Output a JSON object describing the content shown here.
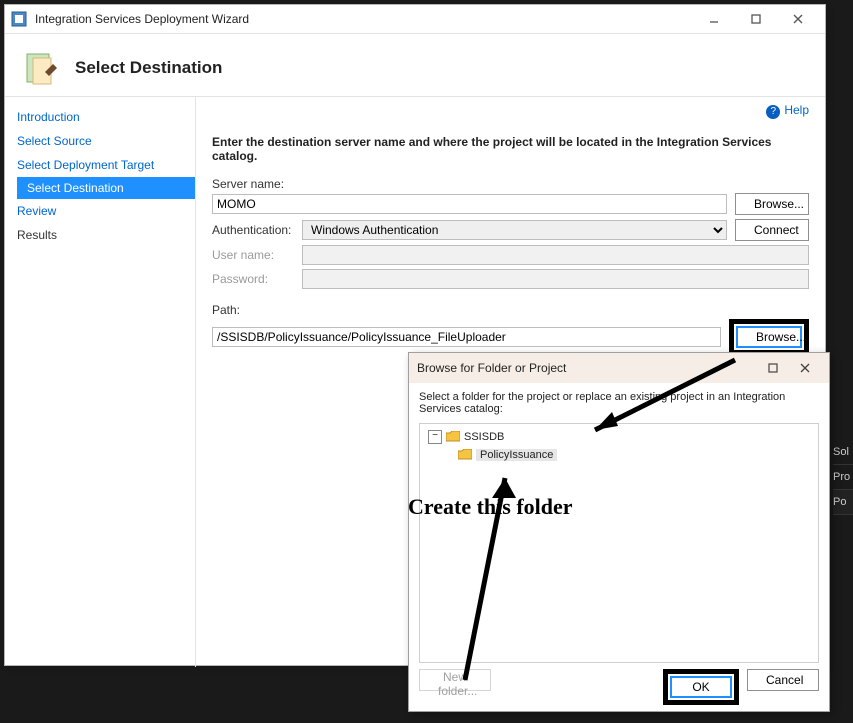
{
  "title": "Integration Services Deployment Wizard",
  "banner_title": "Select Destination",
  "help_label": "Help",
  "nav": {
    "introduction": "Introduction",
    "select_source": "Select Source",
    "select_target": "Select Deployment Target",
    "select_destination": "Select Destination",
    "review": "Review",
    "results": "Results"
  },
  "content": {
    "instruction": "Enter the destination server name and where the project will be located in the Integration Services catalog.",
    "server_label": "Server name:",
    "server_value": "MOMO",
    "browse_label": "Browse...",
    "auth_label": "Authentication:",
    "auth_value": "Windows Authentication",
    "connect_label": "Connect",
    "user_label": "User name:",
    "user_value": "",
    "pwd_label": "Password:",
    "pwd_value": "",
    "path_label": "Path:",
    "path_value": "/SSISDB/PolicyIssuance/PolicyIssuance_FileUploader"
  },
  "dialog": {
    "title": "Browse for Folder or Project",
    "instruction": "Select a folder for the project or replace an existing project in an Integration Services catalog:",
    "root": "SSISDB",
    "child": "PolicyIssuance",
    "new_folder_label": "New folder...",
    "ok_label": "OK",
    "cancel_label": "Cancel"
  },
  "annotation": {
    "text": "Create this folder"
  },
  "side": {
    "sol": "Sol",
    "pro": "Pro",
    "po": "Po"
  }
}
